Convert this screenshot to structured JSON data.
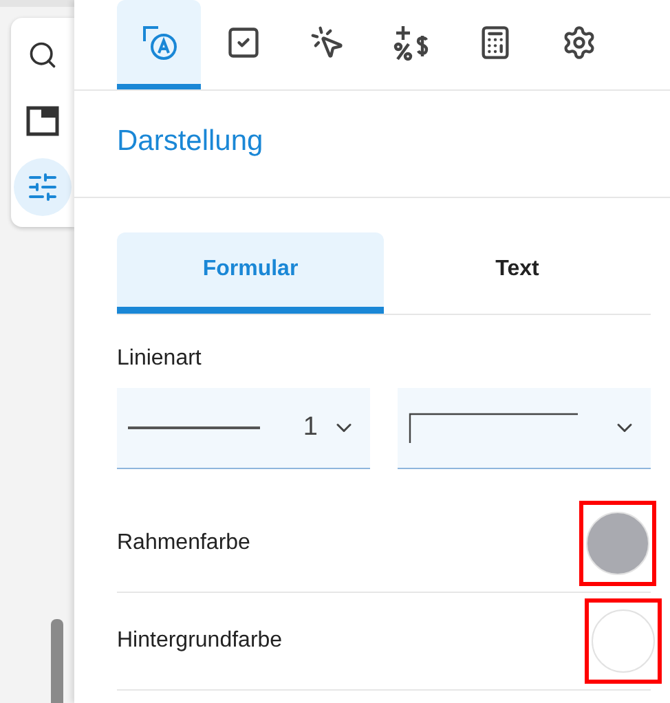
{
  "rail": {
    "items": [
      {
        "kind": "search",
        "selected": false
      },
      {
        "kind": "window",
        "selected": false
      },
      {
        "kind": "sliders",
        "selected": true
      }
    ]
  },
  "icon_tabs": [
    {
      "kind": "appearance",
      "selected": true
    },
    {
      "kind": "checkbox",
      "selected": false
    },
    {
      "kind": "click",
      "selected": false
    },
    {
      "kind": "calc-format",
      "selected": false
    },
    {
      "kind": "calculator",
      "selected": false
    },
    {
      "kind": "settings",
      "selected": false
    }
  ],
  "section_title": "Darstellung",
  "sub_tabs": [
    {
      "label": "Formular",
      "selected": true
    },
    {
      "label": "Text",
      "selected": false
    }
  ],
  "line_style": {
    "label": "Linienart",
    "width_value": "1"
  },
  "color_rows": [
    {
      "label": "Rahmenfarbe",
      "color": "#a9aab0",
      "highlighted": true
    },
    {
      "label": "Hintergrundfarbe",
      "color": "#ffffff",
      "highlighted": true
    }
  ]
}
